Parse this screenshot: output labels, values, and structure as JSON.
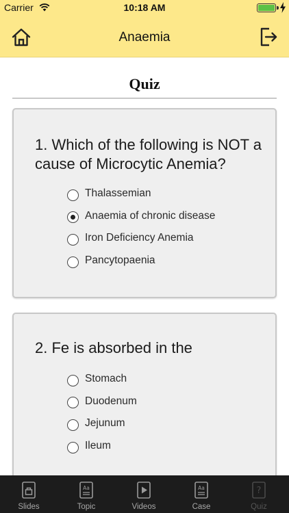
{
  "status_bar": {
    "carrier": "Carrier",
    "time": "10:18 AM",
    "battery_level": 1.0,
    "battery_color": "#5cc146",
    "icons": [
      "wifi-icon",
      "battery-icon",
      "charging-icon"
    ]
  },
  "header": {
    "title": "Anaemia",
    "background": "#fde88a",
    "left_icon": "home-icon",
    "right_icon": "exit-icon"
  },
  "page": {
    "heading": "Quiz"
  },
  "questions": [
    {
      "text": "1. Which of the following is NOT a cause of Microcytic Anemia?",
      "options": [
        "Thalassemian",
        "Anaemia of chronic disease",
        "Iron Deficiency Anemia",
        "Pancytopaenia"
      ],
      "selected": 1
    },
    {
      "text": "2. Fe is absorbed in the",
      "options": [
        "Stomach",
        "Duodenum",
        "Jejunum",
        "Ileum"
      ],
      "selected": null
    }
  ],
  "tab_bar": {
    "tabs": [
      {
        "label": "Slides",
        "icon": "slides-icon"
      },
      {
        "label": "Topic",
        "icon": "topic-icon"
      },
      {
        "label": "Videos",
        "icon": "videos-icon"
      },
      {
        "label": "Case",
        "icon": "case-icon"
      },
      {
        "label": "Quiz",
        "icon": "quiz-icon",
        "active": true
      }
    ]
  }
}
